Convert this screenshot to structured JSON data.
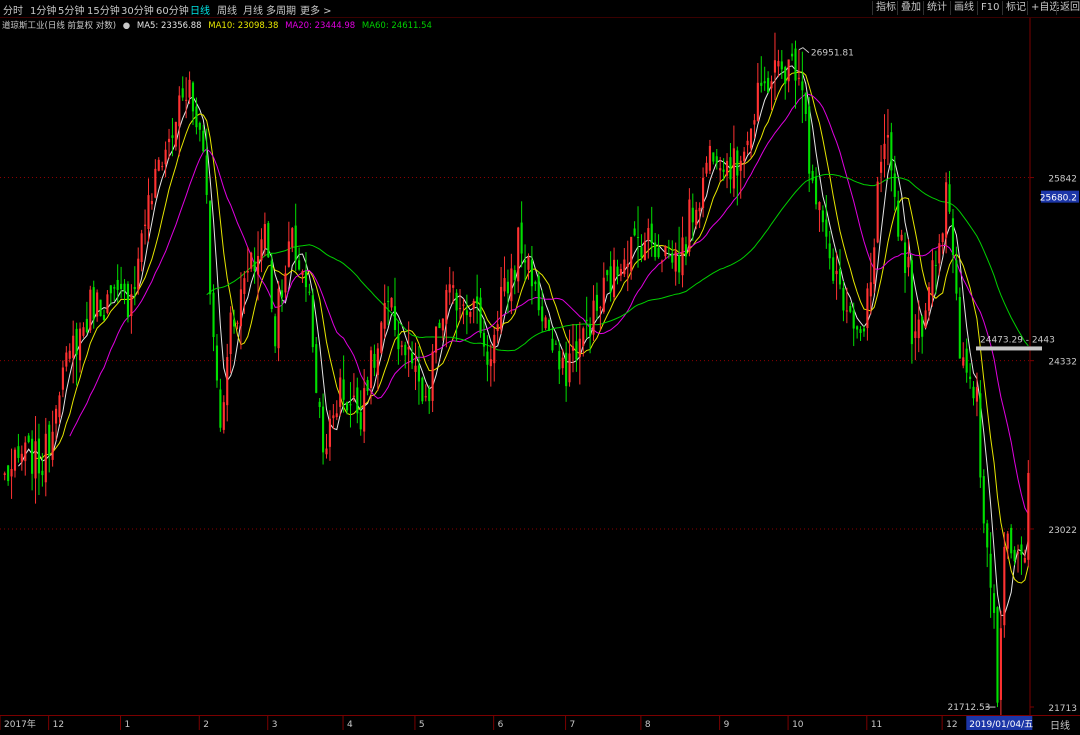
{
  "toolbar": {
    "periods": [
      "分时",
      "1分钟",
      "5分钟",
      "15分钟",
      "30分钟",
      "60分钟",
      "日线",
      "周线",
      "月线",
      "多周期",
      "更多 >"
    ],
    "active_period": "日线",
    "right_buttons": [
      "指标",
      "叠加",
      "统计",
      "画线",
      "F10",
      "标记",
      "+自选",
      "返回"
    ]
  },
  "legend": {
    "name": "道琼斯工业(日线 前复权 对数)",
    "ma5": "MA5: 23356.88",
    "ma10": "MA10: 23098.38",
    "ma20": "MA20: 23444.98",
    "ma60": "MA60: 24611.54"
  },
  "annotations": {
    "high": "26951.81",
    "low": "21712.53",
    "current_box": "25680.2",
    "measure": "24473.29 - 2443"
  },
  "footer": {
    "period_label": "日线",
    "cursor_date": "2019/01/04/五"
  },
  "colors": {
    "up": "#ff3232",
    "down": "#00e000",
    "ma5": "#e6e6e6",
    "ma10": "#e6e600",
    "ma20": "#e000e0",
    "ma60": "#00d000",
    "grid": "#8c0000",
    "axis_text": "#c8c8c8",
    "highlight": "#1c36a8"
  },
  "chart_data": {
    "type": "candlestick",
    "title": "道琼斯工业(日线 前复权 对数)",
    "scale": "log",
    "ylim": [
      21713,
      27100
    ],
    "y_ticks": [
      "25842",
      "24332",
      "23022",
      "21713"
    ],
    "x_ticks": [
      "2017年",
      "12",
      "1",
      "2",
      "3",
      "4",
      "5",
      "6",
      "7",
      "8",
      "9",
      "10",
      "11",
      "12"
    ],
    "grid": true,
    "start_date": "2017-11-13",
    "end_date": "2019-01-04",
    "close_anchors": [
      [
        "2017-11-13",
        23420
      ],
      [
        "2017-11-20",
        23590
      ],
      [
        "2017-11-28",
        23520
      ],
      [
        "2017-12-05",
        24180
      ],
      [
        "2017-12-18",
        24790
      ],
      [
        "2018-01-02",
        24820
      ],
      [
        "2018-01-12",
        25800
      ],
      [
        "2018-01-26",
        26616
      ],
      [
        "2018-02-01",
        26150
      ],
      [
        "2018-02-08",
        23860
      ],
      [
        "2018-02-13",
        24640
      ],
      [
        "2018-02-27",
        25410
      ],
      [
        "2018-03-02",
        24538
      ],
      [
        "2018-03-09",
        25335
      ],
      [
        "2018-03-16",
        24946
      ],
      [
        "2018-03-23",
        23533
      ],
      [
        "2018-03-29",
        24103
      ],
      [
        "2018-04-06",
        23932
      ],
      [
        "2018-04-18",
        24748
      ],
      [
        "2018-04-30",
        24163
      ],
      [
        "2018-05-03",
        23930
      ],
      [
        "2018-05-11",
        24831
      ],
      [
        "2018-05-22",
        24834
      ],
      [
        "2018-05-29",
        24362
      ],
      [
        "2018-06-11",
        25322
      ],
      [
        "2018-06-22",
        24580
      ],
      [
        "2018-06-28",
        24216
      ],
      [
        "2018-07-11",
        24700
      ],
      [
        "2018-07-24",
        25240
      ],
      [
        "2018-08-01",
        25333
      ],
      [
        "2018-08-15",
        25162
      ],
      [
        "2018-08-29",
        26125
      ],
      [
        "2018-09-07",
        25917
      ],
      [
        "2018-09-21",
        26743
      ],
      [
        "2018-10-03",
        26828
      ],
      [
        "2018-10-10",
        25598
      ],
      [
        "2018-10-24",
        24583
      ],
      [
        "2018-10-29",
        24443
      ],
      [
        "2018-11-08",
        26191
      ],
      [
        "2018-11-20",
        24465
      ],
      [
        "2018-11-29",
        25338
      ],
      [
        "2018-12-03",
        25826
      ],
      [
        "2018-12-07",
        24389
      ],
      [
        "2018-12-14",
        24100
      ],
      [
        "2018-12-24",
        21792
      ],
      [
        "2018-12-26",
        22878
      ],
      [
        "2019-01-03",
        22686
      ],
      [
        "2019-01-04",
        23433
      ]
    ],
    "series": [
      {
        "name": "MA5",
        "value": 23356.88
      },
      {
        "name": "MA10",
        "value": 23098.38
      },
      {
        "name": "MA20",
        "value": 23444.98
      },
      {
        "name": "MA60",
        "value": 24611.54
      }
    ],
    "high": {
      "value": 26951.81,
      "date": "2018-10-03"
    },
    "low": {
      "value": 21712.53,
      "date": "2018-12-24"
    }
  }
}
